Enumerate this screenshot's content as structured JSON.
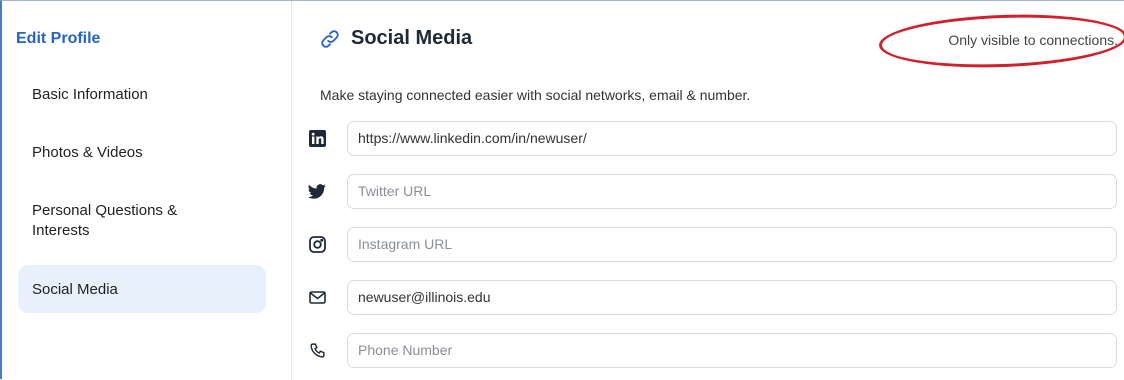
{
  "sidebar": {
    "title": "Edit Profile",
    "items": [
      {
        "label": "Basic Information"
      },
      {
        "label": "Photos & Videos"
      },
      {
        "label": "Personal Questions & Interests"
      },
      {
        "label": "Social Media",
        "active": true
      }
    ]
  },
  "main": {
    "title": "Social Media",
    "title_icon": "link-icon",
    "visibility_note": "Only visible to connections.",
    "description": "Make staying connected easier with social networks, email & number.",
    "fields": [
      {
        "icon": "linkedin-icon",
        "value": "https://www.linkedin.com/in/newuser/",
        "placeholder": ""
      },
      {
        "icon": "twitter-icon",
        "value": "",
        "placeholder": "Twitter URL"
      },
      {
        "icon": "instagram-icon",
        "value": "",
        "placeholder": "Instagram URL"
      },
      {
        "icon": "mail-icon",
        "value": "newuser@illinois.edu",
        "placeholder": ""
      },
      {
        "icon": "phone-icon",
        "value": "",
        "placeholder": "Phone Number"
      }
    ]
  },
  "colors": {
    "accent": "#2563c9",
    "active_bg": "#e8f0fb",
    "annotation": "#d21f2a"
  }
}
